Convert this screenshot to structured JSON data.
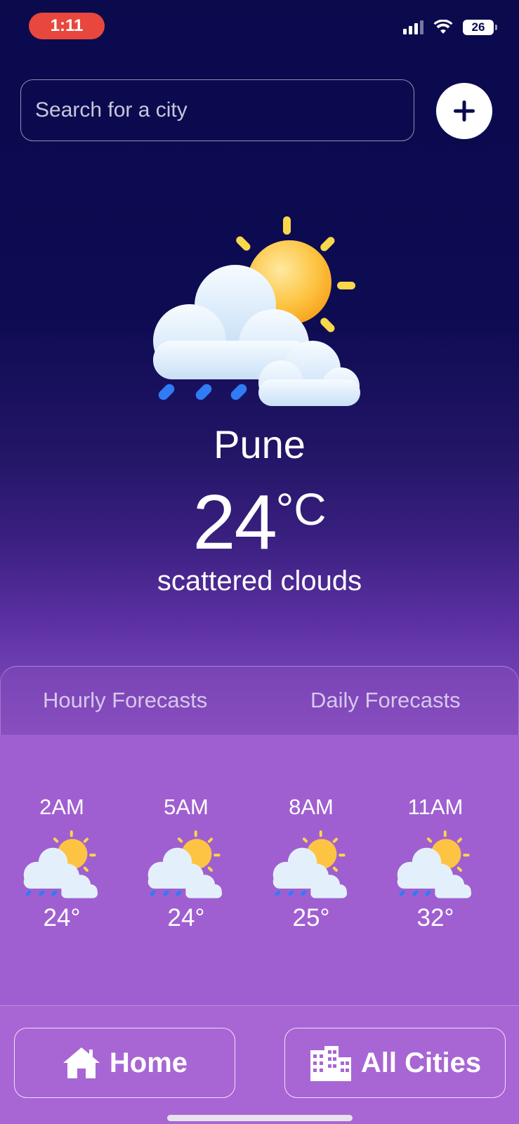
{
  "status_bar": {
    "time": "1:11",
    "battery": "26"
  },
  "search": {
    "placeholder": "Search for a city"
  },
  "current": {
    "city": "Pune",
    "temperature": "24",
    "unit": "°C",
    "description": "scattered clouds",
    "icon": "sun-cloud-rain-icon"
  },
  "tabs": [
    {
      "label": "Hourly Forecasts"
    },
    {
      "label": "Daily Forecasts"
    }
  ],
  "hourly": [
    {
      "time": "2AM",
      "temp": "24°",
      "icon": "sun-cloud-rain-icon"
    },
    {
      "time": "5AM",
      "temp": "24°",
      "icon": "sun-cloud-rain-icon"
    },
    {
      "time": "8AM",
      "temp": "25°",
      "icon": "sun-cloud-rain-icon"
    },
    {
      "time": "11AM",
      "temp": "32°",
      "icon": "sun-cloud-rain-icon"
    }
  ],
  "nav": {
    "home_label": "Home",
    "cities_label": "All Cities"
  },
  "colors": {
    "time_pill": "#e8473d",
    "panel": "#a05fd0",
    "sun": "#fdb735",
    "rain": "#2f7cf5"
  }
}
